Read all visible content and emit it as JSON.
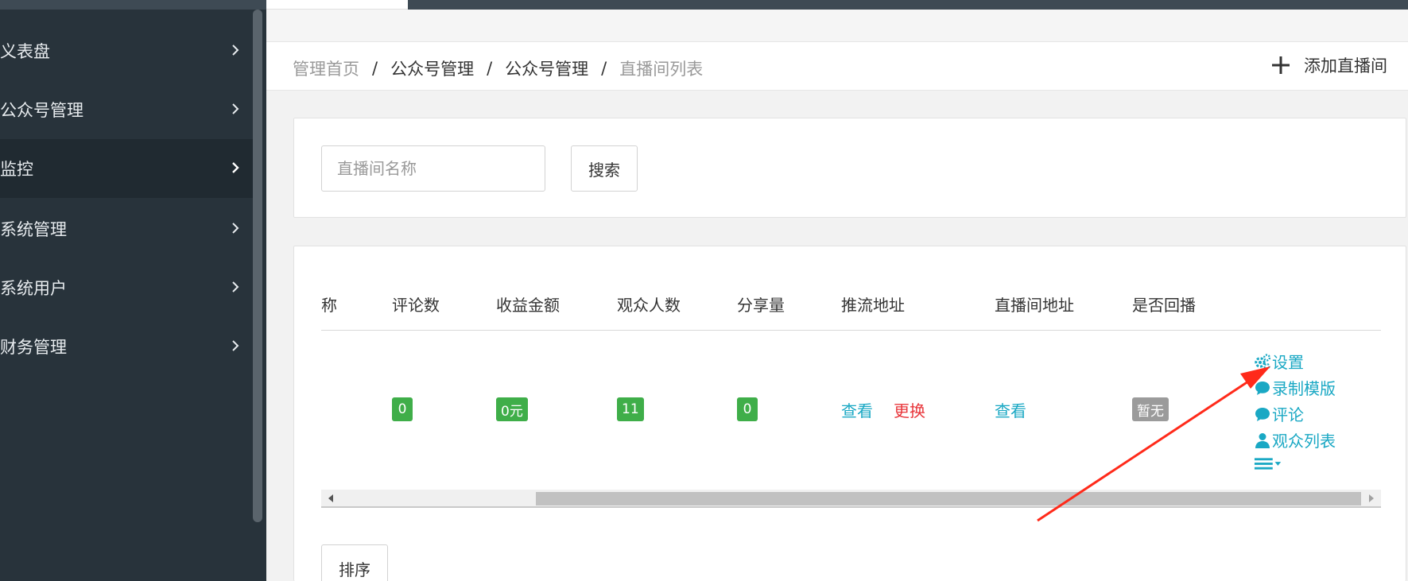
{
  "sidebar": {
    "items": [
      {
        "label": "义表盘",
        "active": false
      },
      {
        "label": "公众号管理",
        "active": false
      },
      {
        "label": "监控",
        "active": true
      },
      {
        "label": "系统管理",
        "active": false
      },
      {
        "label": "系统用户",
        "active": false
      },
      {
        "label": "财务管理",
        "active": false
      }
    ]
  },
  "breadcrumb": {
    "items": [
      "管理首页",
      "公众号管理",
      "公众号管理",
      "直播间列表"
    ],
    "separator": "/"
  },
  "header": {
    "add_button_label": "添加直播间"
  },
  "search": {
    "placeholder": "直播间名称",
    "value": "",
    "button_label": "搜索"
  },
  "table": {
    "columns": [
      "称",
      "评论数",
      "收益金额",
      "观众人数",
      "分享量",
      "推流地址",
      "直播间地址",
      "是否回播"
    ],
    "row": {
      "comments": "0",
      "revenue": "0元",
      "viewers": "11",
      "shares": "0",
      "push_view": "查看",
      "push_change": "更换",
      "room_view": "查看",
      "replay": "暂无"
    },
    "actions": [
      "设置",
      "录制模版",
      "评论",
      "观众列表"
    ]
  },
  "sort_button_label": "排序",
  "colors": {
    "sidebar_bg": "#28333b",
    "accent_link": "#1aa8c4",
    "badge_green": "#3fae49",
    "badge_grey": "#9b9b9b",
    "danger": "#e8363b",
    "annotation": "#ff2a1a"
  }
}
